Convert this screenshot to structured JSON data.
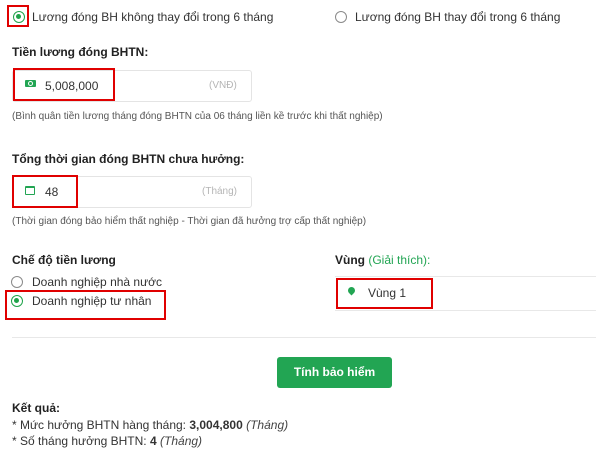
{
  "contribution_mode": {
    "options": [
      {
        "label": "Lương đóng BH không thay đổi trong 6 tháng",
        "selected": true
      },
      {
        "label": "Lương đóng BH thay đổi trong 6 tháng",
        "selected": false
      }
    ]
  },
  "salary": {
    "title": "Tiền lương đóng BHTN:",
    "value": "5,008,000",
    "unit": "(VNĐ)",
    "icon": "money-icon",
    "hint": "(Bình quân tiền lương tháng đóng BHTN của 06 tháng liền kề trước khi thất nghiệp)"
  },
  "duration": {
    "title": "Tổng thời gian đóng BHTN chưa hưởng:",
    "value": "48",
    "unit": "(Tháng)",
    "icon": "calendar-icon",
    "hint": "(Thời gian đóng bảo hiểm thất nghiệp - Thời gian đã hưởng trợ cấp thất nghiệp)"
  },
  "salary_regime": {
    "title": "Chế độ tiền lương",
    "options": [
      {
        "label": "Doanh nghiệp nhà nước",
        "selected": false
      },
      {
        "label": "Doanh nghiệp tư nhân",
        "selected": true
      }
    ]
  },
  "region": {
    "title": "Vùng",
    "explain": "(Giải thích):",
    "value": "Vùng 1",
    "icon": "map-pin-icon"
  },
  "button": {
    "label": "Tính bảo hiểm"
  },
  "result": {
    "title": "Kết quả:",
    "monthly_prefix": "* Mức hưởng BHTN hàng tháng: ",
    "monthly_value": "3,004,800",
    "monthly_unit": "(Tháng)",
    "months_prefix": "* Số tháng hưởng BHTN: ",
    "months_value": "4",
    "months_unit": "(Tháng)"
  },
  "colors": {
    "accent": "#22a553",
    "highlight": "#e00000"
  }
}
